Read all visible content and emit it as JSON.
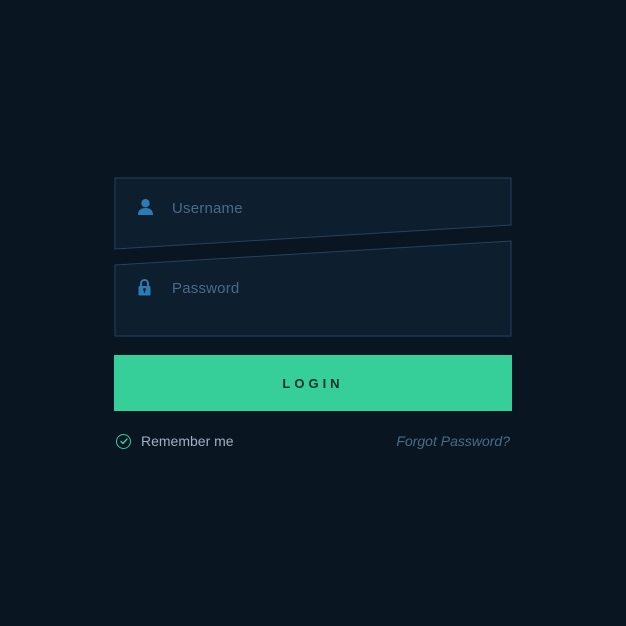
{
  "form": {
    "username_placeholder": "Username",
    "password_placeholder": "Password",
    "login_label": "LOGIN",
    "remember_label": "Remember me",
    "forgot_label": "Forgot Password?"
  },
  "colors": {
    "background": "#091521",
    "border": "#24425f",
    "accent": "#36cf9a",
    "icon": "#2d7bb5"
  }
}
